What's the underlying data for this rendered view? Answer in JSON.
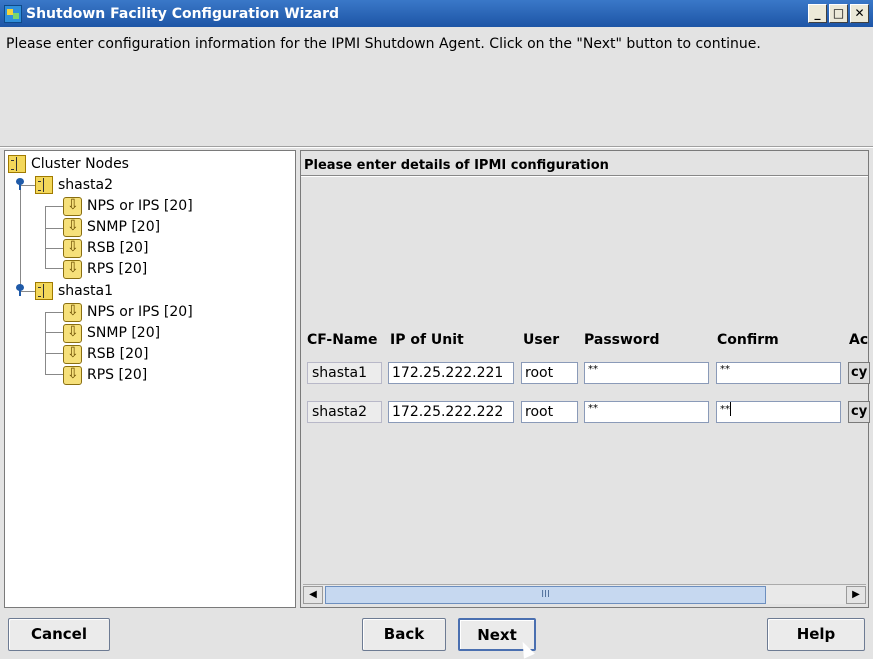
{
  "window": {
    "title": "Shutdown Facility Configuration Wizard",
    "minimize": "_",
    "maximize": "□",
    "close": "✕"
  },
  "instruction": "Please enter configuration information for the IPMI Shutdown Agent. Click on the \"Next\" button to continue.",
  "tree": {
    "root": "Cluster Nodes",
    "nodes": [
      {
        "label": "shasta2",
        "agents": [
          "NPS or IPS [20]",
          "SNMP [20]",
          "RSB [20]",
          "RPS [20]"
        ]
      },
      {
        "label": "shasta1",
        "agents": [
          "NPS or IPS [20]",
          "SNMP [20]",
          "RSB [20]",
          "RPS [20]"
        ]
      }
    ]
  },
  "panel": {
    "heading": "Please enter details of IPMI configuration",
    "columns": [
      "CF-Name",
      "IP of Unit",
      "User",
      "Password",
      "Confirm",
      "Ac"
    ],
    "rows": [
      {
        "cf_name": "shasta1",
        "ip": "172.25.222.221",
        "user": "root",
        "password": "**",
        "confirm": "**",
        "action": "cy"
      },
      {
        "cf_name": "shasta2",
        "ip": "172.25.222.222",
        "user": "root",
        "password": "**",
        "confirm": "**",
        "action": "cy"
      }
    ],
    "scroll_thumb_grip": "III"
  },
  "buttons": {
    "cancel": "Cancel",
    "back": "Back",
    "next": "Next",
    "help": "Help"
  }
}
